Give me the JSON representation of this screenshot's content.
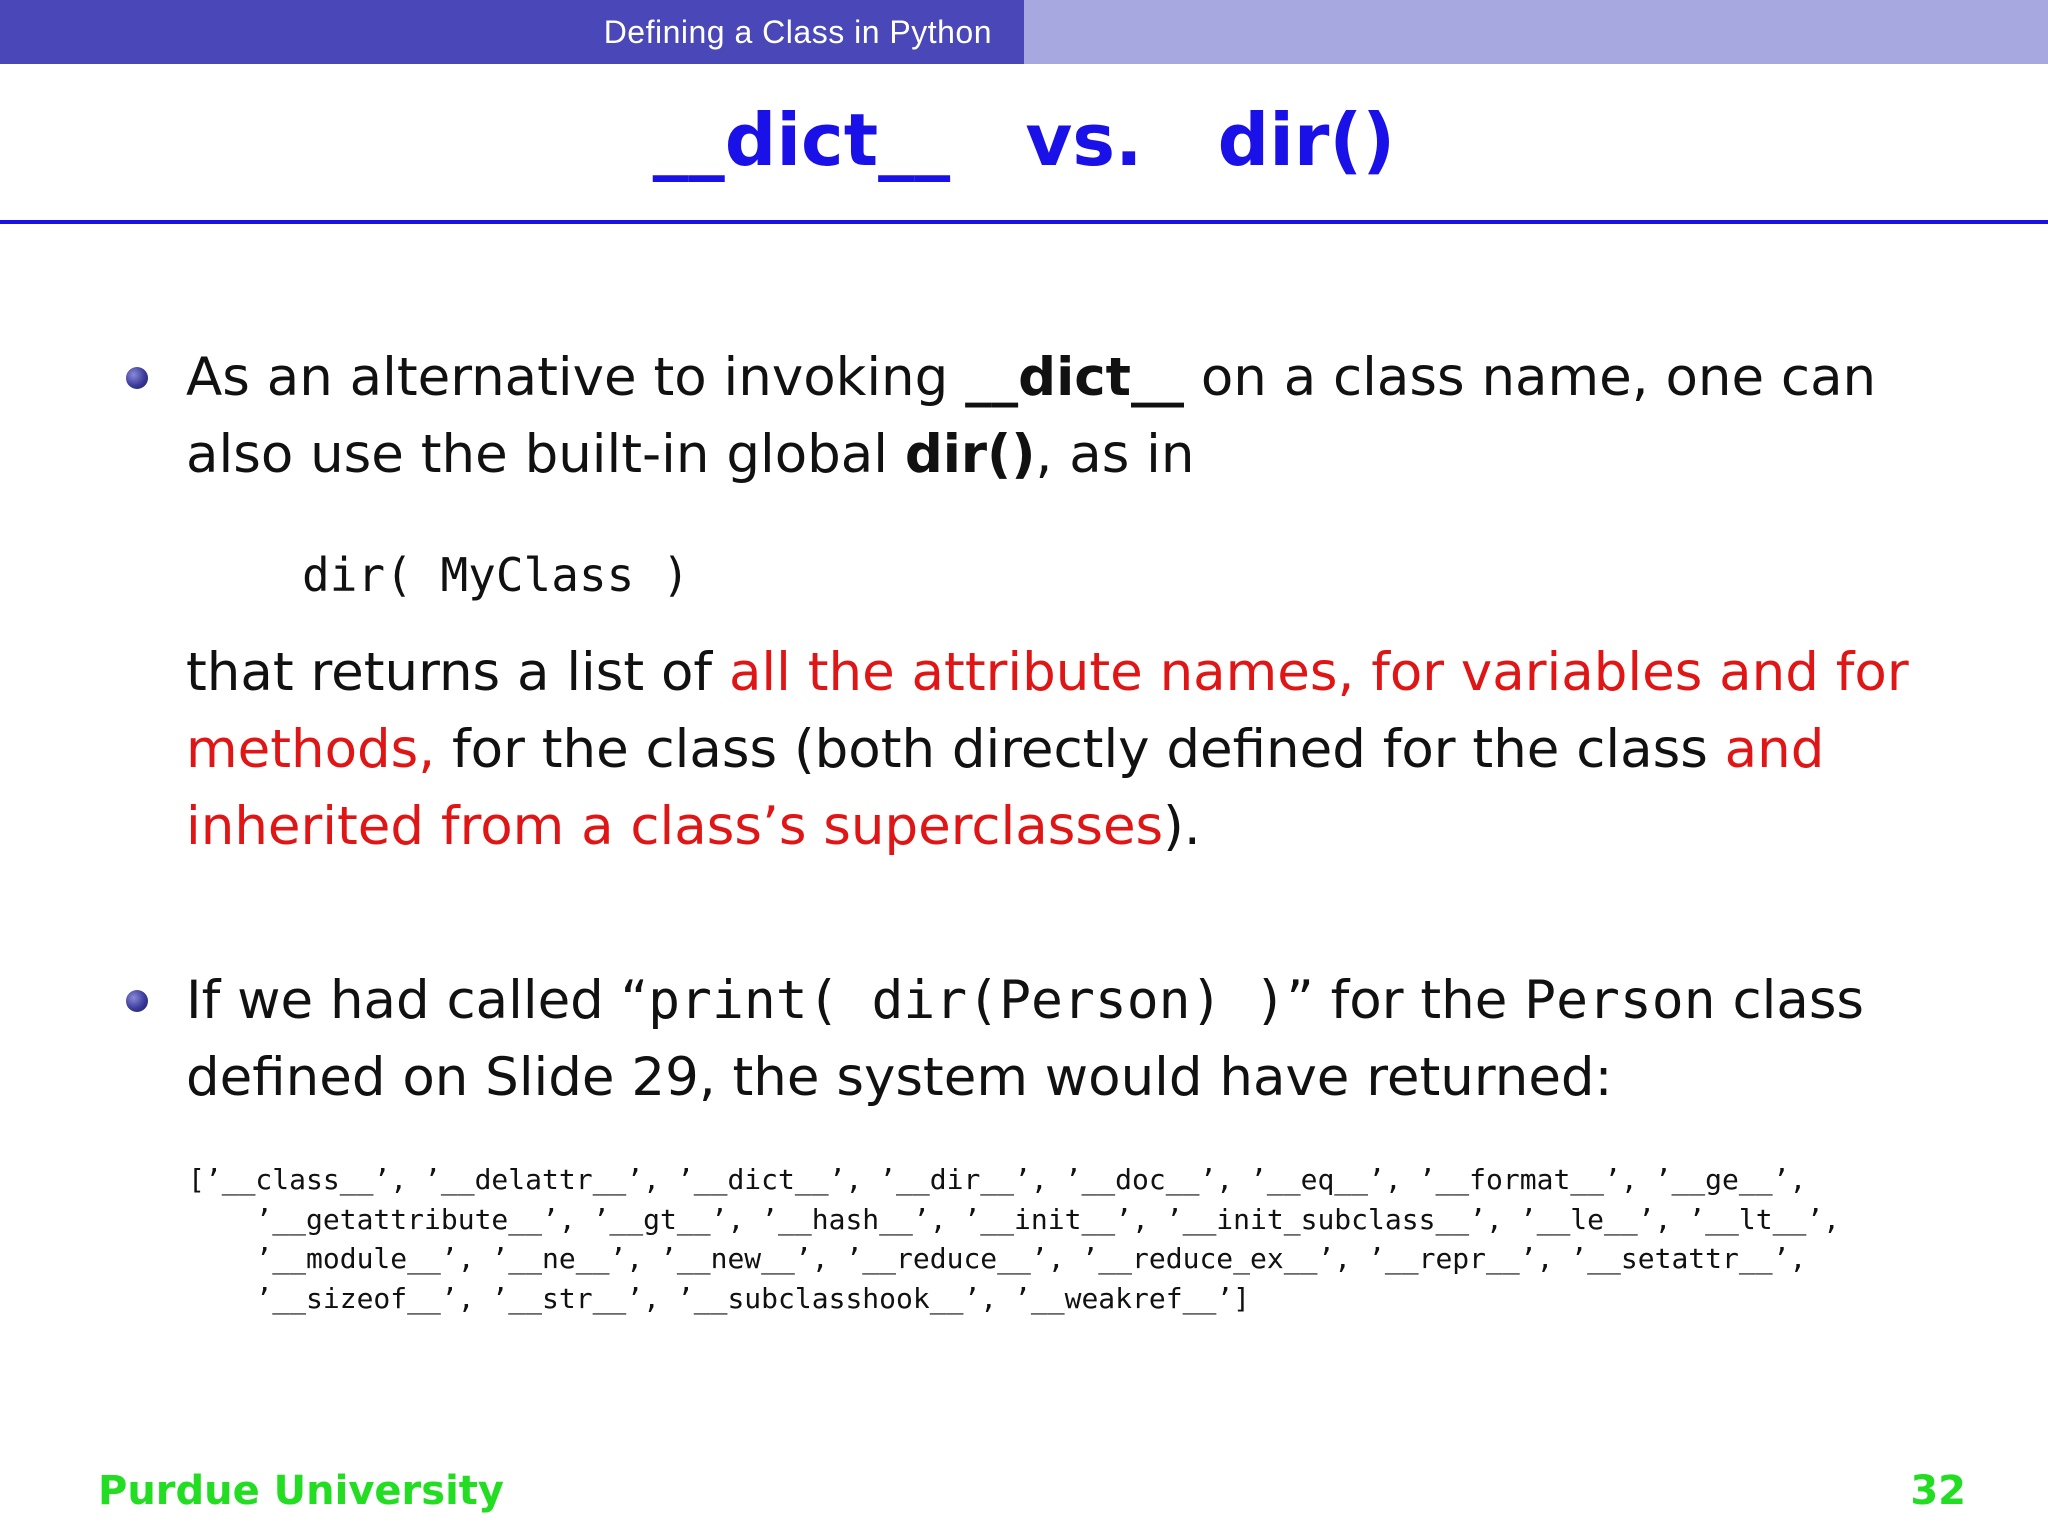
{
  "header": {
    "section_title": "Defining a Class in Python"
  },
  "slide": {
    "title": "__dict__   vs.   dir()"
  },
  "bullet1": {
    "t1": "As an alternative to invoking ",
    "t2": "__dict__",
    "t3": " on a class name, one can also use the built-in global ",
    "t4": "dir()",
    "t5": ", as in",
    "code": "dir( MyClass )",
    "u1": "that returns a list of ",
    "u2": "all the attribute names, for variables and for methods,",
    "u3": " for the class (both directly defined for the class ",
    "u4": "and inherited from a class’s superclasses",
    "u5": ")."
  },
  "bullet2": {
    "t1": "If we had called “",
    "t2": "print( dir(Person) )",
    "t3": "” for the ",
    "t4": "Person",
    "t5": " class defined on Slide 29, the system would have returned:"
  },
  "dir_output": [
    "[’__class__’, ’__delattr__’, ’__dict__’, ’__dir__’, ’__doc__’, ’__eq__’, ’__format__’, ’__ge__’,",
    "    ’__getattribute__’, ’__gt__’, ’__hash__’, ’__init__’, ’__init_subclass__’, ’__le__’, ’__lt__’,",
    "    ’__module__’, ’__ne__’, ’__new__’, ’__reduce__’, ’__reduce_ex__’, ’__repr__’, ’__setattr__’,",
    "    ’__sizeof__’, ’__str__’, ’__subclasshook__’, ’__weakref__’]"
  ],
  "footer": {
    "institution": "Purdue University",
    "page_number": "32"
  },
  "colors": {
    "title_blue": "#1a10e8",
    "header_dark": "#4a48b8",
    "header_light": "#a8a8e0",
    "highlight_red": "#e01515",
    "footer_green": "#22dd22"
  }
}
